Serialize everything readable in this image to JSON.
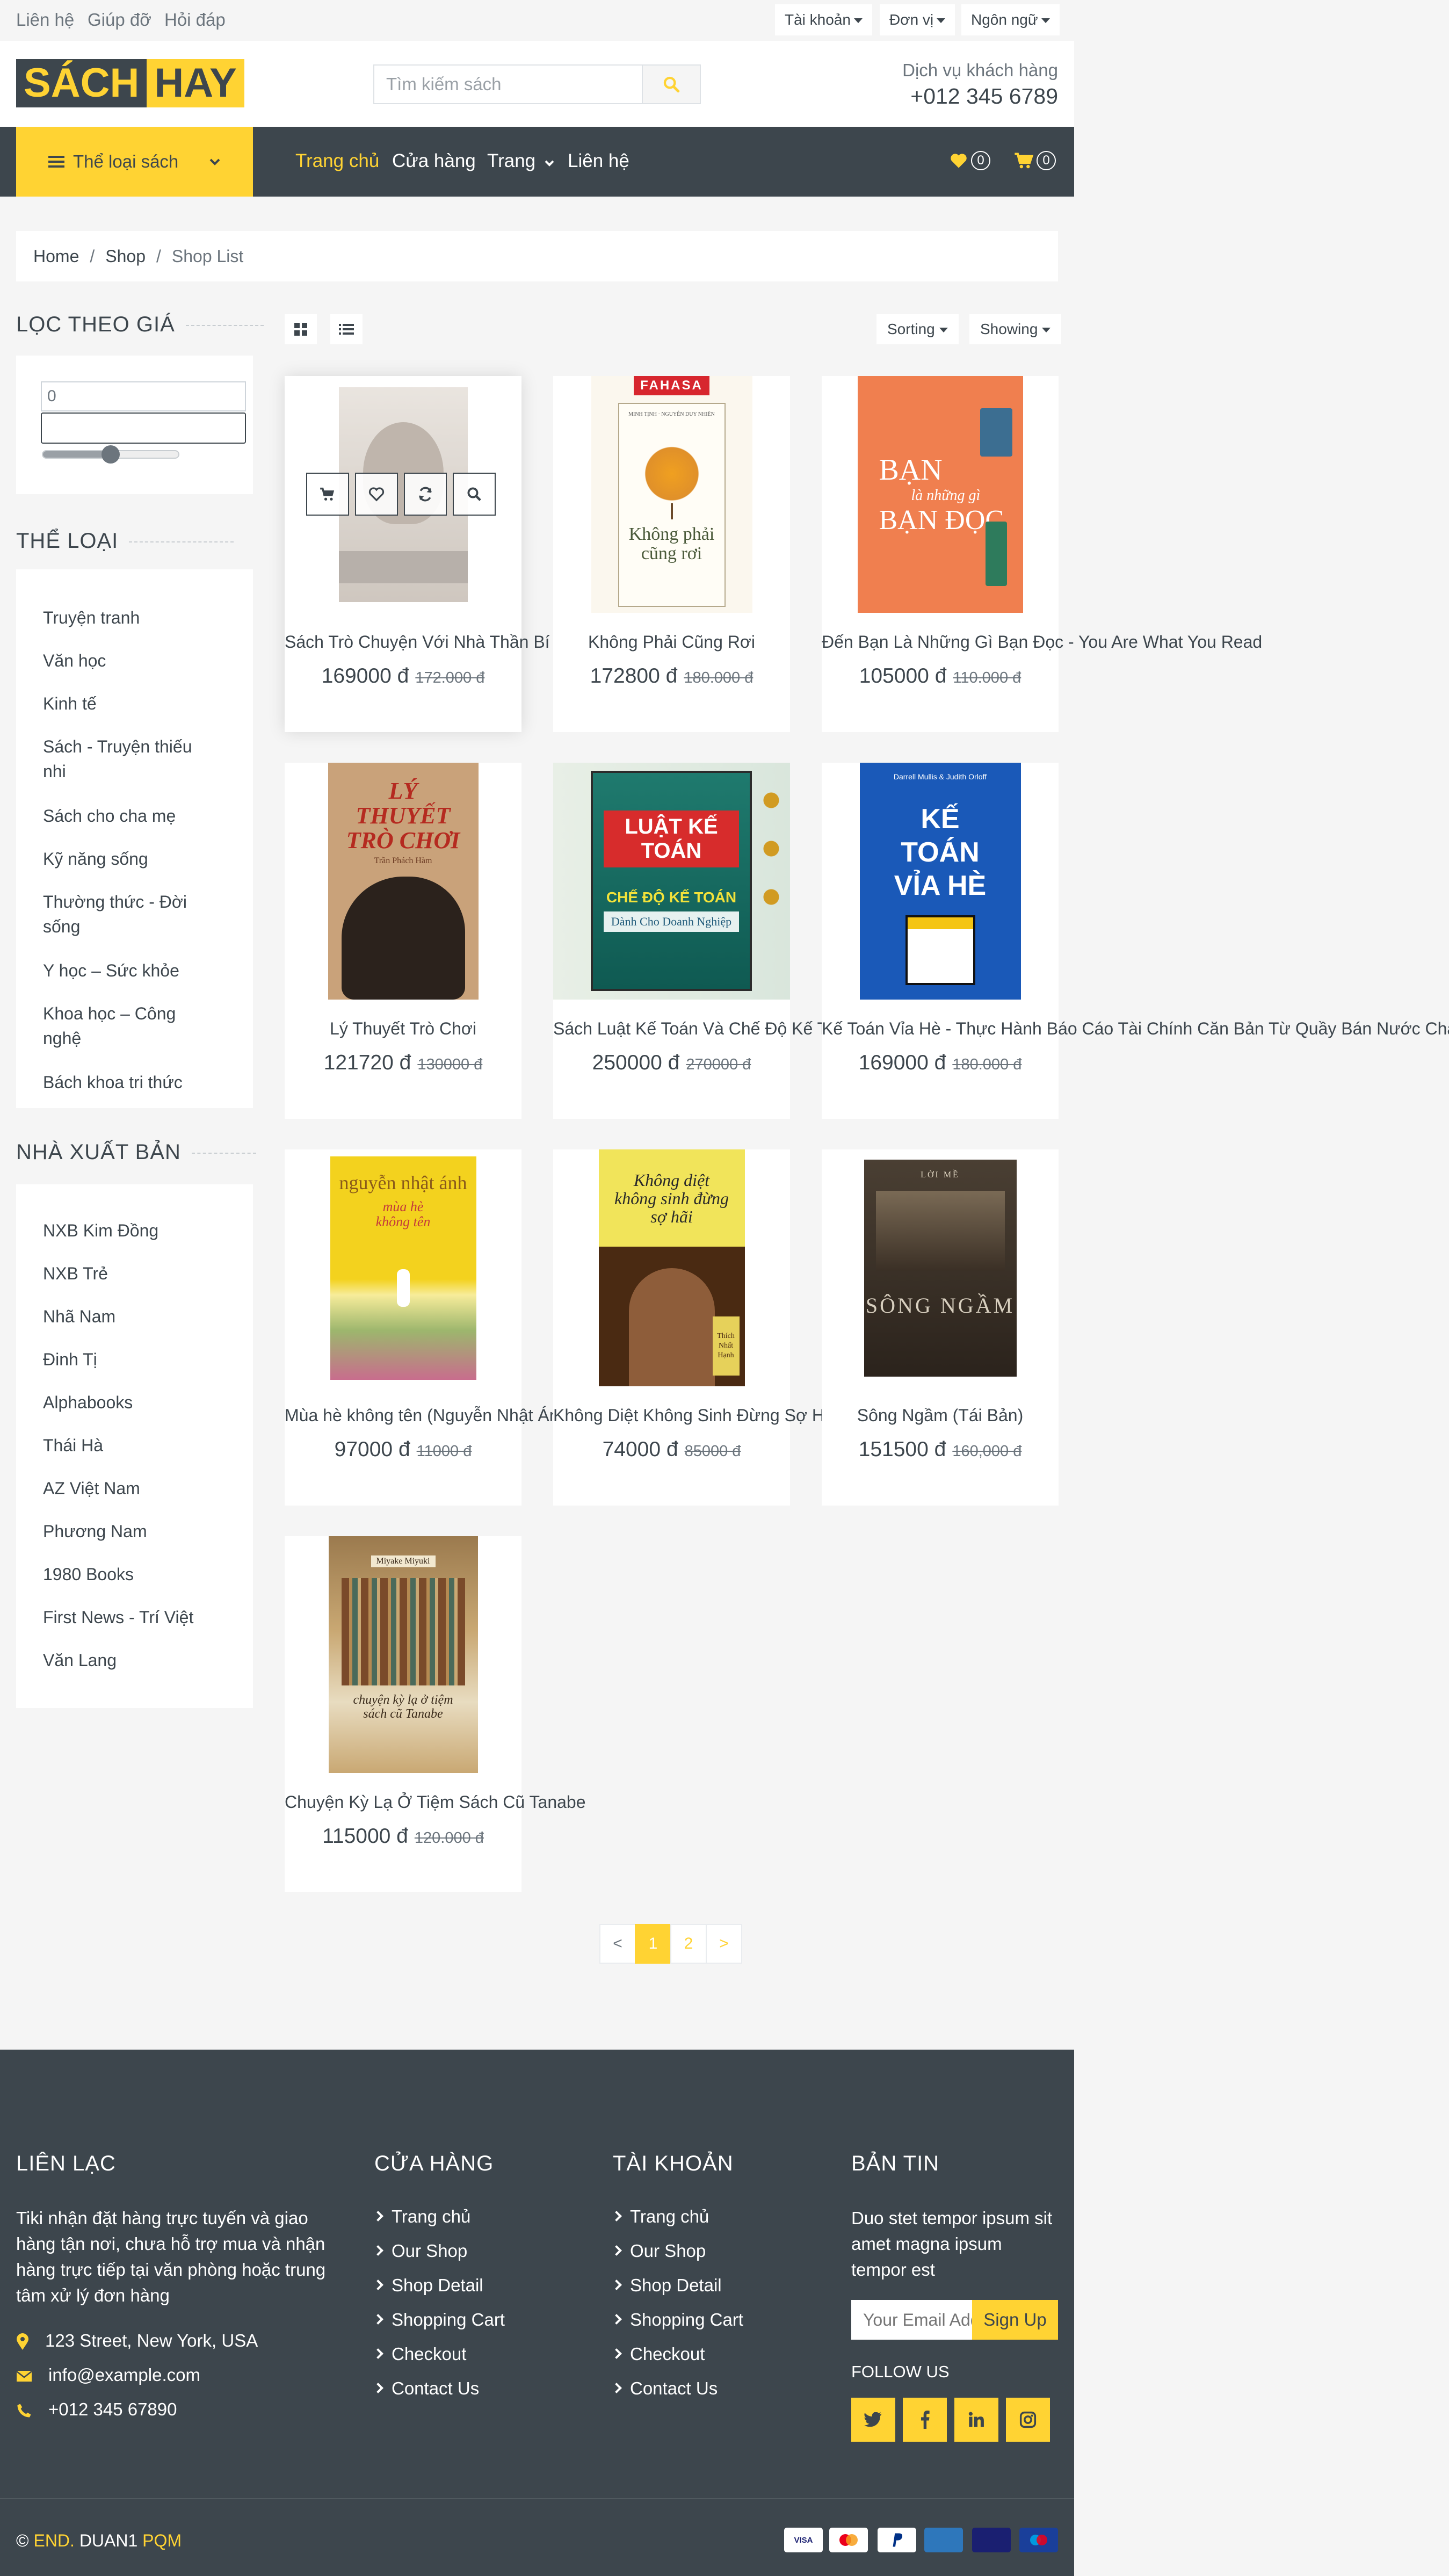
{
  "topbar": {
    "links": [
      "Liên hệ",
      "Giúp đỡ",
      "Hỏi đáp"
    ],
    "dropdowns": [
      "Tài khoản",
      "Đơn vị",
      "Ngôn ngữ"
    ]
  },
  "header": {
    "logo_part1": "SÁCH",
    "logo_part2": "HAY",
    "search_placeholder": "Tìm kiếm sách",
    "service_label": "Dịch vụ khách hàng",
    "service_phone": "+012 345 6789"
  },
  "navbar": {
    "category_button": "Thể loại sách",
    "links": [
      "Trang chủ",
      "Cửa hàng",
      "Trang",
      "Liên hệ"
    ],
    "wishlist_count": "0",
    "cart_count": "0"
  },
  "breadcrumb": [
    "Home",
    "Shop",
    "Shop List"
  ],
  "sidebar": {
    "price_title": "LỌC THEO GIÁ",
    "price_min_value": "0",
    "price_max_value": "",
    "price_slider_fraction": 0.5,
    "category_title": "THỂ LOẠI",
    "categories": [
      "Truyện tranh",
      "Văn học",
      "Kinh tế",
      "Sách - Truyện thiếu nhi",
      "Sách cho cha mẹ",
      "Kỹ năng sống",
      "Thường thức - Đời sống",
      "Y học – Sức khỏe",
      "Khoa học – Công nghệ",
      "Bách khoa tri thức"
    ],
    "publisher_title": "NHÀ XUẤT BẢN",
    "publishers": [
      "NXB Kim Đồng",
      "NXB Trẻ",
      "Nhã Nam",
      "Đinh Tị",
      "Alphabooks",
      "Thái Hà",
      "AZ Việt Nam",
      "Phương Nam",
      "1980 Books",
      "First News - Trí Việt",
      "Văn Lang"
    ]
  },
  "toolbar": {
    "sorting": "Sorting",
    "showing": "Showing"
  },
  "products": [
    {
      "title": "Sách Trò Chuyện Với Nhà Thần Bí - ",
      "price": "169000 đ",
      "old_price": "172.000 đ"
    },
    {
      "title": "Không Phải Cũng Rơi",
      "price": "172800 đ",
      "old_price": "180.000 đ"
    },
    {
      "title": "Đến Bạn Là Những Gì Bạn Đọc - You Are What You Read",
      "price": "105000 đ",
      "old_price": "110.000 đ"
    },
    {
      "title": "Lý Thuyết Trò Chơi",
      "price": "121720 đ",
      "old_price": "130000 đ"
    },
    {
      "title": "Sách Luật Kế Toán Và Chế Độ Kế To",
      "price": "250000 đ",
      "old_price": "270000 đ"
    },
    {
      "title": "Kế Toán Vỉa Hè - Thực Hành Báo Cáo Tài Chính Căn Bản Từ Quầy Bán Nước Chanh",
      "price": "169000 đ",
      "old_price": "180.000 đ"
    },
    {
      "title": "Mùa hè không tên (Nguyễn Nhật Ánh",
      "price": "97000 đ",
      "old_price": "11000 đ"
    },
    {
      "title": "Không Diệt Không Sinh Đừng Sợ Hã",
      "price": "74000 đ",
      "old_price": "85000 đ"
    },
    {
      "title": "Sông Ngầm (Tái Bản)",
      "price": "151500 đ",
      "old_price": "160,000 đ"
    },
    {
      "title": "Chuyện Kỳ Lạ Ở Tiệm Sách Cũ Tanabe",
      "price": "115000 đ",
      "old_price": "120.000 đ"
    }
  ],
  "covers": {
    "c2_brand": "FAHASA",
    "c2_author": "MINH TỊNH · NGUYỄN DUY NHIÊN",
    "c2_title": "Không phải cũng rơi",
    "c3_title1": "BẠN",
    "c3_title2": "là những gì",
    "c3_title3": "BẠN ĐỌC",
    "c4_title": "LÝ THUYẾT TRÒ CHƠI",
    "c4_author": "Trần Phách Hàm",
    "c5_title1": "LUẬT KẾ TOÁN",
    "c5_title2": "CHẾ ĐỘ KẾ TOÁN",
    "c5_title3": "Dành Cho Doanh Nghiệp",
    "c6_author": "Darrell Mullis & Judith Orloff",
    "c6_title": "KẾ TOÁN VỈA HÈ",
    "c7_author": "nguyễn nhật ánh",
    "c7_title": "mùa hè không tên",
    "c8_title": "Không diệt không sinh đừng sợ hãi",
    "c8_author": "Thích Nhất Hạnh",
    "c9_top": "LỜI MỀ",
    "c9_title": "SÔNG NGẦM",
    "c10_author": "Miyake Miyuki",
    "c10_title": "chuyện kỳ lạ ở tiệm sách cũ Tanabe"
  },
  "pagination": [
    "<",
    "1",
    "2",
    ">"
  ],
  "footer": {
    "contact_title": "LIÊN LẠC",
    "contact_text": "Tiki nhận đặt hàng trực tuyến và giao hàng tận nơi, chưa hỗ trợ mua và nhận hàng trực tiếp tại văn phòng hoặc trung tâm xử lý đơn hàng",
    "address": "123 Street, New York, USA",
    "email": "info@example.com",
    "phone": "+012 345 67890",
    "shop_title": "CỬA HÀNG",
    "account_title": "TÀI KHOẢN",
    "links": [
      "Trang chủ",
      "Our Shop",
      "Shop Detail",
      "Shopping Cart",
      "Checkout",
      "Contact Us"
    ],
    "news_title": "BẢN TIN",
    "news_text": "Duo stet tempor ipsum sit amet magna ipsum tempor est",
    "email_placeholder": "Your Email Address",
    "signup": "Sign Up",
    "follow_title": "FOLLOW US",
    "copy_symbol": "©",
    "copy_end": "END.",
    "copy_mid": "DUAN1",
    "copy_brand": "PQM",
    "payments": [
      "VISA",
      "MC",
      "PayPal",
      "AMEX",
      "VISA Electron",
      "Maestro"
    ]
  },
  "colors": {
    "accent": "#ffd333",
    "dark": "#3d464d",
    "bg": "#f5f5f5"
  }
}
